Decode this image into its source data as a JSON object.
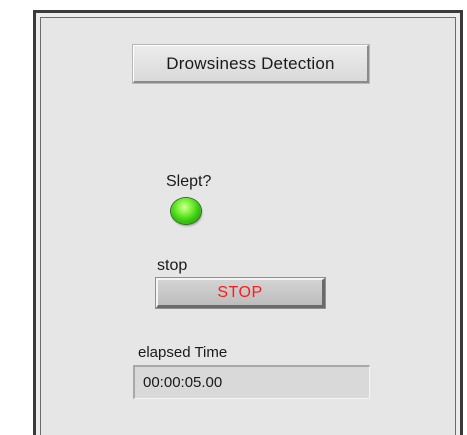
{
  "panel": {
    "title": "Drowsiness Detection"
  },
  "indicator": {
    "label": "Slept?",
    "state": "on",
    "color": "#38c810"
  },
  "stop_control": {
    "label": "stop",
    "button_text": "STOP",
    "button_text_color": "#ff1a1a"
  },
  "elapsed": {
    "label": "elapsed Time",
    "value": "00:00:05.00"
  }
}
